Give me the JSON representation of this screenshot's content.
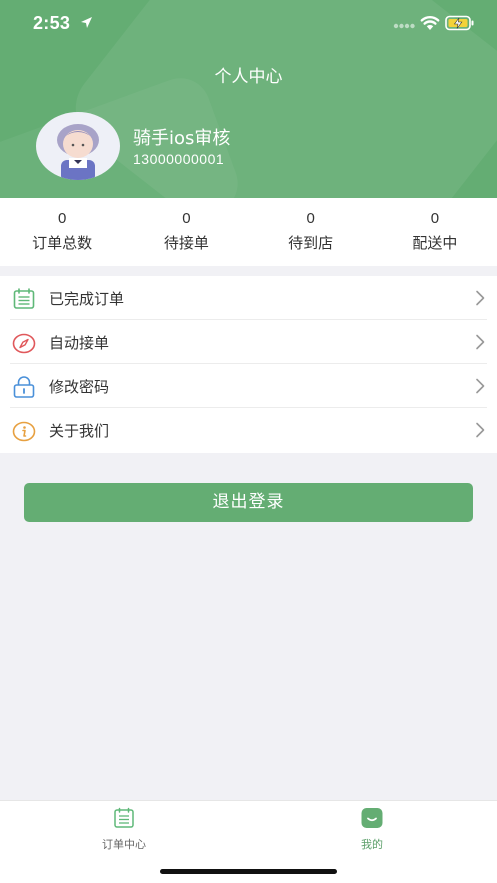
{
  "status_bar": {
    "time": "2:53"
  },
  "header": {
    "title": "个人中心",
    "user_name": "骑手ios审核",
    "phone": "13000000001"
  },
  "stats": [
    {
      "value": "0",
      "label": "订单总数"
    },
    {
      "value": "0",
      "label": "待接单"
    },
    {
      "value": "0",
      "label": "待到店"
    },
    {
      "value": "0",
      "label": "配送中"
    }
  ],
  "menu": [
    {
      "label": "已完成订单",
      "icon": "calendar-icon"
    },
    {
      "label": "自动接单",
      "icon": "compass-icon"
    },
    {
      "label": "修改密码",
      "icon": "lock-icon"
    },
    {
      "label": "关于我们",
      "icon": "info-icon"
    }
  ],
  "logout_label": "退出登录",
  "tabs": [
    {
      "label": "订单中心",
      "icon": "order-list-icon",
      "active": false
    },
    {
      "label": "我的",
      "icon": "profile-icon",
      "active": true
    }
  ],
  "colors": {
    "primary": "#64ad73",
    "background": "#f1f1f5",
    "text": "#333333",
    "icon_green": "#5fb878",
    "icon_red": "#e0585b",
    "icon_blue": "#4a90d9",
    "icon_orange": "#e7a040"
  }
}
